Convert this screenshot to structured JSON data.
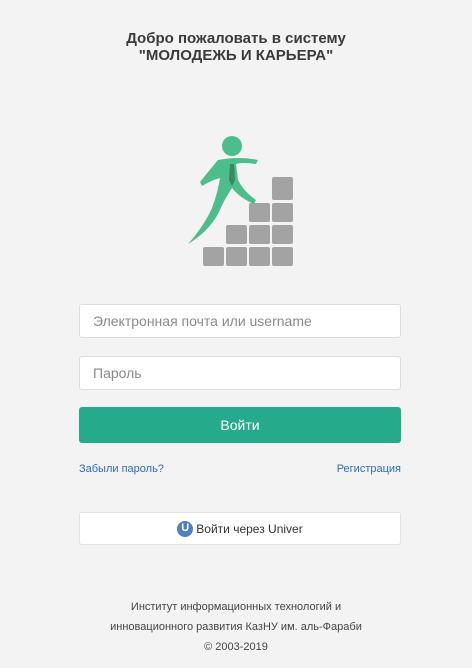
{
  "header": {
    "title_line1": "Добро пожаловать в систему",
    "title_line2": "\"МОЛОДЕЖЬ И КАРЬЕРА\""
  },
  "logo": {
    "icon": "person-climbing-blocks-logo",
    "figure_color": "#4dbd8c",
    "tie_color": "#3b8a5e",
    "block_color": "#a3a3a3"
  },
  "login_form": {
    "email_placeholder": "Электронная почта или username",
    "email_value": "",
    "password_placeholder": "Пароль",
    "password_value": "",
    "submit_label": "Войти",
    "submit_color": "#25ab8c",
    "forgot_link": "Забыли пароль?",
    "register_link": "Регистрация",
    "link_color": "#2f6db5"
  },
  "univer_login": {
    "icon": "univer-u-icon",
    "icon_letter": "U",
    "label": "Войти через Univer"
  },
  "footer": {
    "line1": "Институт информационных технологий и",
    "line2": "инновационного развития КазНУ им. аль-Фараби",
    "line3": "© 2003-2019"
  }
}
